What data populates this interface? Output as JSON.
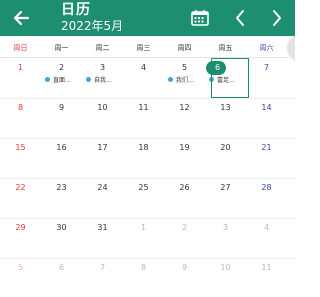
{
  "header": {
    "title": "日历",
    "subtitle": "2022年5月",
    "back_icon": "arrow-left-icon",
    "today_icon": "calendar-today-icon",
    "prev_icon": "chevron-left-icon",
    "next_icon": "chevron-right-icon"
  },
  "weekdays": [
    "周日",
    "周一",
    "周二",
    "周三",
    "周四",
    "周五",
    "周六"
  ],
  "weeks": [
    [
      {
        "day": "1"
      },
      {
        "day": "2",
        "event": "直面…"
      },
      {
        "day": "3",
        "event": "自我…"
      },
      {
        "day": "4"
      },
      {
        "day": "5",
        "event": "我们…"
      },
      {
        "day": "6",
        "event": "富足…",
        "selected": true
      },
      {
        "day": "7"
      }
    ],
    [
      {
        "day": "8"
      },
      {
        "day": "9"
      },
      {
        "day": "10"
      },
      {
        "day": "11"
      },
      {
        "day": "12"
      },
      {
        "day": "13"
      },
      {
        "day": "14"
      }
    ],
    [
      {
        "day": "15"
      },
      {
        "day": "16"
      },
      {
        "day": "17"
      },
      {
        "day": "18"
      },
      {
        "day": "19"
      },
      {
        "day": "20"
      },
      {
        "day": "21"
      }
    ],
    [
      {
        "day": "22"
      },
      {
        "day": "23"
      },
      {
        "day": "24"
      },
      {
        "day": "25"
      },
      {
        "day": "26"
      },
      {
        "day": "27"
      },
      {
        "day": "28"
      }
    ],
    [
      {
        "day": "29"
      },
      {
        "day": "30"
      },
      {
        "day": "31"
      },
      {
        "day": "1",
        "other": true
      },
      {
        "day": "2",
        "other": true
      },
      {
        "day": "3",
        "other": true
      },
      {
        "day": "4",
        "other": true
      }
    ],
    [
      {
        "day": "5",
        "other": true
      },
      {
        "day": "6",
        "other": true
      },
      {
        "day": "7",
        "other": true
      },
      {
        "day": "8",
        "other": true
      },
      {
        "day": "9",
        "other": true
      },
      {
        "day": "10",
        "other": true
      },
      {
        "day": "11",
        "other": true
      }
    ]
  ],
  "colors": {
    "accent": "#1e8e70",
    "sunday": "#e53935",
    "saturday": "#3949ab",
    "event_dot": "#42a5d5"
  }
}
